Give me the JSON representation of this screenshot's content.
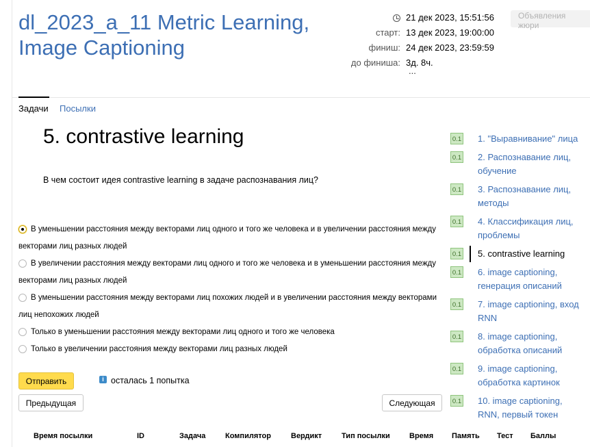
{
  "contest": {
    "title_line1": "dl_2023_a_11 Metric Learning,",
    "title_line2": "Image Captioning",
    "now": "21 дек 2023, 15:51:56",
    "start_label": "старт:",
    "start": "13 дек 2023, 19:00:00",
    "finish_label": "финиш:",
    "finish": "24 дек 2023, 23:59:59",
    "remaining_label": "до финиша:",
    "remaining": "3д. 8ч.",
    "ellipsis": "...",
    "jury_button": "Объявления жюри"
  },
  "tabs": [
    {
      "label": "Задачи",
      "active": true
    },
    {
      "label": "Посылки",
      "active": false
    }
  ],
  "problem": {
    "title": "5. contrastive learning",
    "question": "В чем состоит идея contrastive learning в задаче распознавания лиц?",
    "options": [
      {
        "line1": "В уменьшении расстояния между векторами лиц одного и того же человека и в увеличении расстояния между",
        "line2": "векторами лиц разных людей",
        "selected": true
      },
      {
        "line1": "В увеличении расстояния между векторами лиц одного и того же человека и в уменьшении расстояния между",
        "line2": "векторами лиц разных людей",
        "selected": false
      },
      {
        "line1": "В уменьшении расстояния между векторами лиц похожих людей и в увеличении расстояния между векторами",
        "line2": "лиц непохожих людей",
        "selected": false
      },
      {
        "line1": "Только в уменьшении расстояния между векторами лиц одного и того же человека",
        "line2": "",
        "selected": false
      },
      {
        "line1": "Только в увеличении расстояния между векторами лиц разных людей",
        "line2": "",
        "selected": false
      }
    ],
    "submit_label": "Отправить",
    "info_icon": "i",
    "attempts_text": "осталась 1 попытка",
    "prev_label": "Предыдущая",
    "next_label": "Следующая"
  },
  "submissions_table": {
    "headers": [
      "Время посылки",
      "ID",
      "Задача",
      "Компилятор",
      "Вердикт",
      "Тип посылки",
      "Время",
      "Память",
      "Тест",
      "Баллы"
    ]
  },
  "problem_list": [
    {
      "badge": "0.1",
      "line1": "1. \"Выравнивание\" лица",
      "line2": "",
      "current": false
    },
    {
      "badge": "0.1",
      "line1": "2. Распознавание лиц,",
      "line2": "обучение",
      "current": false
    },
    {
      "badge": "0.1",
      "line1": "3. Распознавание лиц,",
      "line2": "методы",
      "current": false
    },
    {
      "badge": "0.1",
      "line1": "4. Классификация лиц,",
      "line2": "проблемы",
      "current": false
    },
    {
      "badge": "0.1",
      "line1": "5. contrastive learning",
      "line2": "",
      "current": true
    },
    {
      "badge": "0.1",
      "line1": "6. image captioning,",
      "line2": "генерация описаний",
      "current": false
    },
    {
      "badge": "0.1",
      "line1": "7. image captioning, вход",
      "line2": "RNN",
      "current": false
    },
    {
      "badge": "0.1",
      "line1": "8. image captioning,",
      "line2": "обработка описаний",
      "current": false
    },
    {
      "badge": "0.1",
      "line1": "9. image captioning,",
      "line2": "обработка картинок",
      "current": false
    },
    {
      "badge": "0.1",
      "line1": "10. image captioning,",
      "line2": "RNN, первый токен",
      "current": false
    }
  ],
  "colors": {
    "accent": "#3d6fb4",
    "submit": "#ffdb4d",
    "badge_bg": "#cde8c3"
  }
}
